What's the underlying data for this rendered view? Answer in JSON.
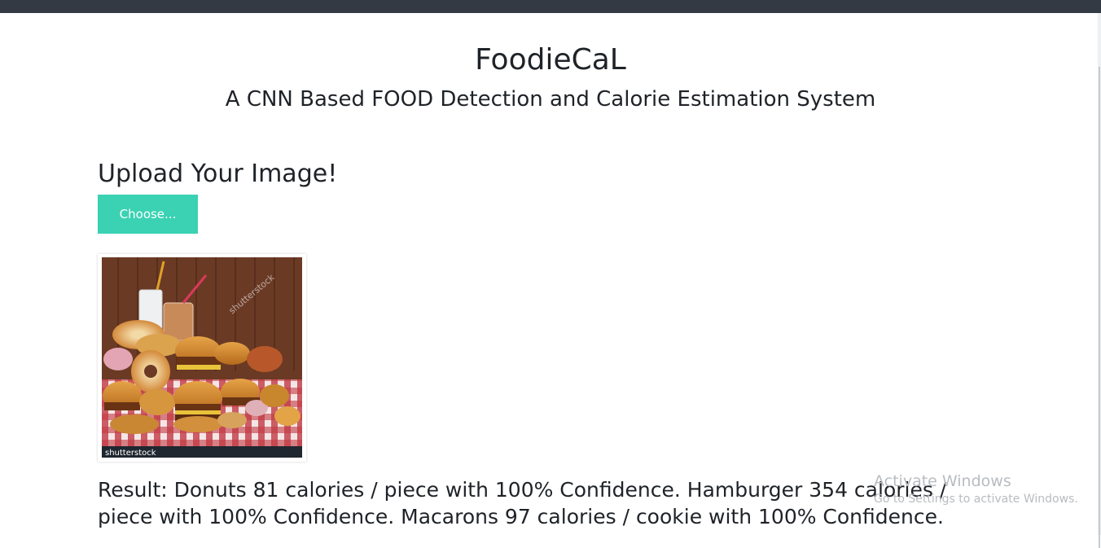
{
  "app": {
    "title": "FoodieCaL",
    "subtitle": "A CNN Based FOOD Detection and Calorie Estimation System"
  },
  "upload": {
    "heading": "Upload Your Image!",
    "choose_label": "Choose..."
  },
  "preview": {
    "watermark_text": "shutterstock",
    "footer_brand": "shutterstock"
  },
  "result": {
    "text": "Result: Donuts 81 calories / piece with 100% Confidence. Hamburger 354 calories / piece with 100% Confidence. Macarons 97 calories / cookie with 100% Confidence."
  },
  "os_overlay": {
    "title": "Activate Windows",
    "subtitle": "Go to Settings to activate Windows."
  },
  "colors": {
    "topbar": "#343a44",
    "button": "#3ad2b3",
    "text": "#1f2328"
  }
}
